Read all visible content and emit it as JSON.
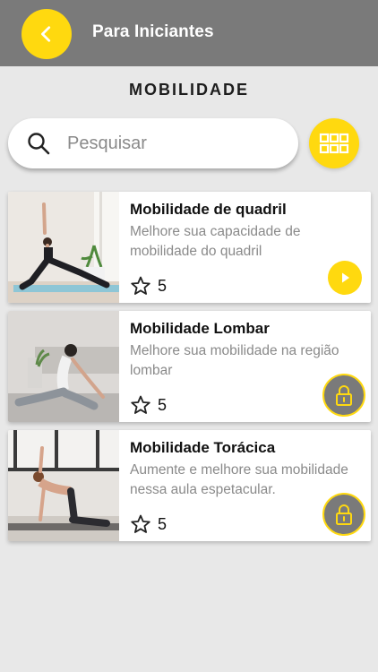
{
  "header": {
    "title": "Para Iniciantes",
    "back_icon": "chevron-left-icon",
    "bar_color": "#7a7a7a",
    "accent_color": "#ffd90f"
  },
  "section": {
    "title": "MOBILIDADE"
  },
  "search": {
    "placeholder": "Pesquisar",
    "value": "",
    "icon": "search-icon"
  },
  "view_toggle": {
    "icon": "grid-icon"
  },
  "classes": [
    {
      "title": "Mobilidade de quadril",
      "description": "Melhore sua capacidade de mobilidade do quadril",
      "rating": "5",
      "action": "play",
      "action_icon": "play-icon"
    },
    {
      "title": "Mobilidade Lombar",
      "description": "Melhore sua mobilidade na região lombar",
      "rating": "5",
      "action": "locked",
      "action_icon": "lock-icon"
    },
    {
      "title": "Mobilidade Torácica",
      "description": "Aumente e melhore sua mobilidade nessa aula espetacular.",
      "rating": "5",
      "action": "locked",
      "action_icon": "lock-icon"
    }
  ]
}
